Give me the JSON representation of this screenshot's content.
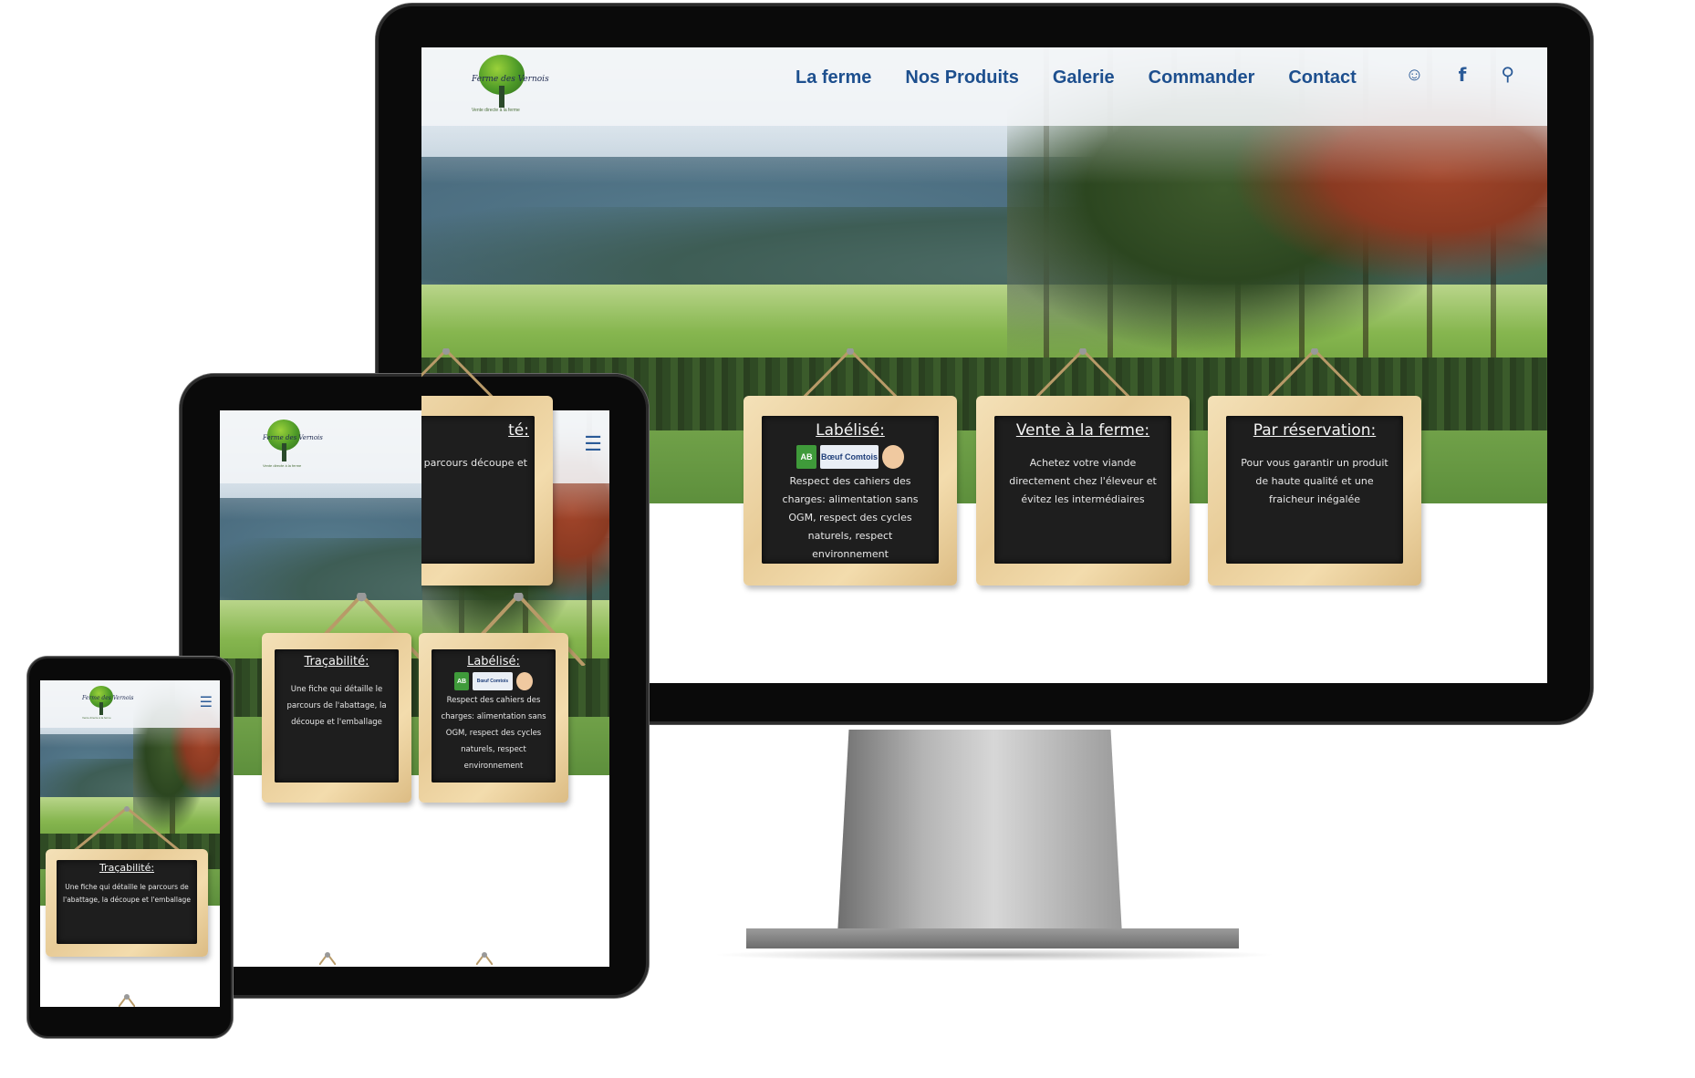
{
  "site": {
    "logo_name": "Ferme des Vernois",
    "logo_slogan": "Vente directe à la ferme"
  },
  "nav": {
    "items": [
      "La ferme",
      "Nos Produits",
      "Galerie",
      "Commander",
      "Contact"
    ]
  },
  "header_icons": [
    "user-icon",
    "facebook-icon",
    "search-icon"
  ],
  "menu_icon": "hamburger-menu-icon",
  "boards": [
    {
      "title": "Traçabilité:",
      "body": "Une fiche qui détaille le parcours de l'abattage, la découpe et l'emballage"
    },
    {
      "title": "Labélisé:",
      "badges": [
        "AB",
        "Bœuf Comtois",
        "Label"
      ],
      "body": "Respect des cahiers des charges: alimentation sans OGM, respect des cycles naturels, respect environnement"
    },
    {
      "title": "Vente à la ferme:",
      "body": "Achetez votre viande directement chez l'éleveur et évitez les intermédiaires"
    },
    {
      "title": "Par réservation:",
      "body": "Pour vous garantir un produit de haute qualité et une fraicheur inégalée"
    }
  ],
  "monitor_partial": {
    "title_tail": "té:",
    "body_tail": "le parcours découpe et"
  },
  "colors": {
    "nav_text": "#1d4f8e",
    "slate": "#1e1e1e",
    "wood": "#e8cc98",
    "device": "#0a0a0a"
  }
}
